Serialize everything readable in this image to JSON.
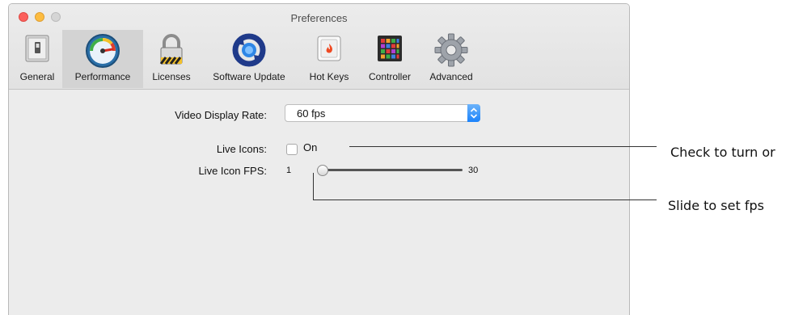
{
  "window": {
    "title": "Preferences",
    "buttons": [
      "close",
      "minimize",
      "zoom"
    ]
  },
  "toolbar": {
    "items": [
      {
        "label": "General",
        "icon": "switch-icon"
      },
      {
        "label": "Performance",
        "icon": "speedometer-icon",
        "selected": true
      },
      {
        "label": "Licenses",
        "icon": "padlock-icon"
      },
      {
        "label": "Software Update",
        "icon": "update-arrows-icon"
      },
      {
        "label": "Hot Keys",
        "icon": "flame-key-icon"
      },
      {
        "label": "Controller",
        "icon": "pad-controller-icon"
      },
      {
        "label": "Advanced",
        "icon": "gear-icon"
      }
    ]
  },
  "settings": {
    "video_display_rate": {
      "label": "Video Display Rate:",
      "value": "60 fps"
    },
    "live_icons": {
      "label": "Live Icons:",
      "checkbox_label": "On",
      "checked": false
    },
    "live_icon_fps": {
      "label": "Live Icon FPS:",
      "min": "1",
      "max": "30",
      "value": 1
    }
  },
  "callouts": {
    "checkbox": "Check to turn or",
    "slider": "Slide to set fps"
  },
  "colors": {
    "accent": "#1a82fb",
    "selected_tab": "#d3d3d3"
  }
}
